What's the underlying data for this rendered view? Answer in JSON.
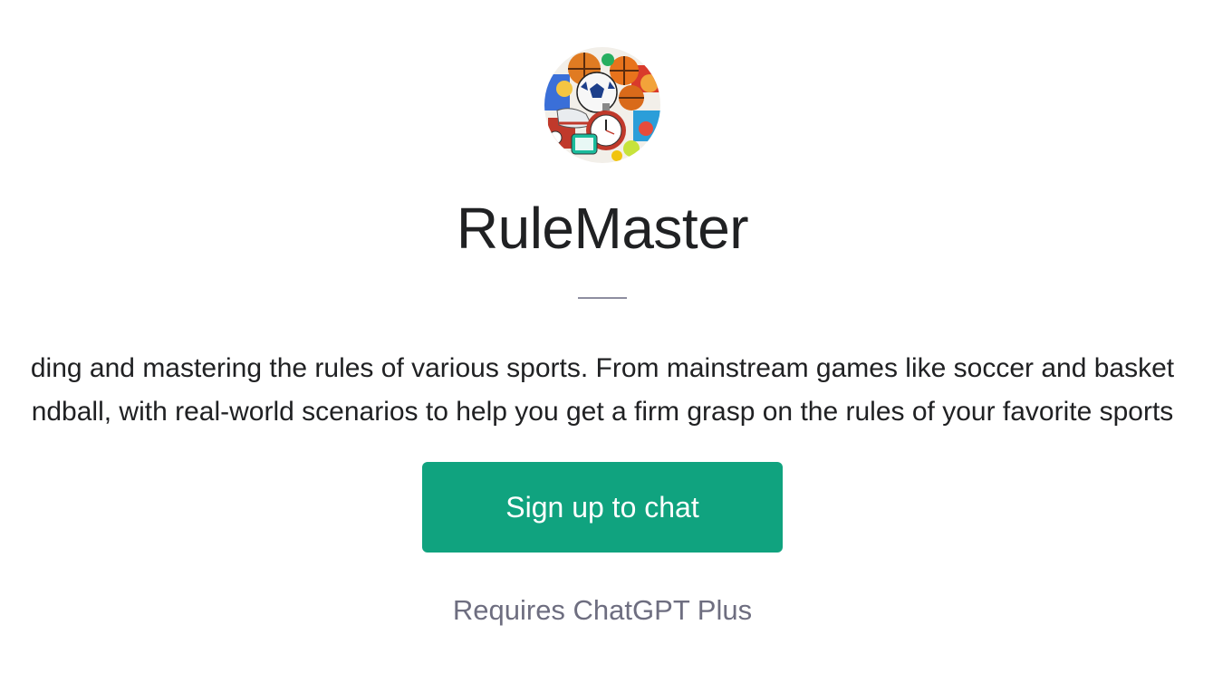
{
  "gpt": {
    "avatar_icon": "sports-collage-icon",
    "title": "RuleMaster",
    "description_lines": [
      "ding and mastering the rules of various sports. From mainstream games like soccer and basket",
      "ndball, with real-world scenarios to help you get a firm grasp on the rules of your favorite sports"
    ]
  },
  "cta": {
    "signup_label": "Sign up to chat",
    "requirement": "Requires ChatGPT Plus"
  },
  "colors": {
    "accent": "#10a37f",
    "text": "#202123",
    "muted": "#6e6e80",
    "divider": "#8e8ea0"
  }
}
